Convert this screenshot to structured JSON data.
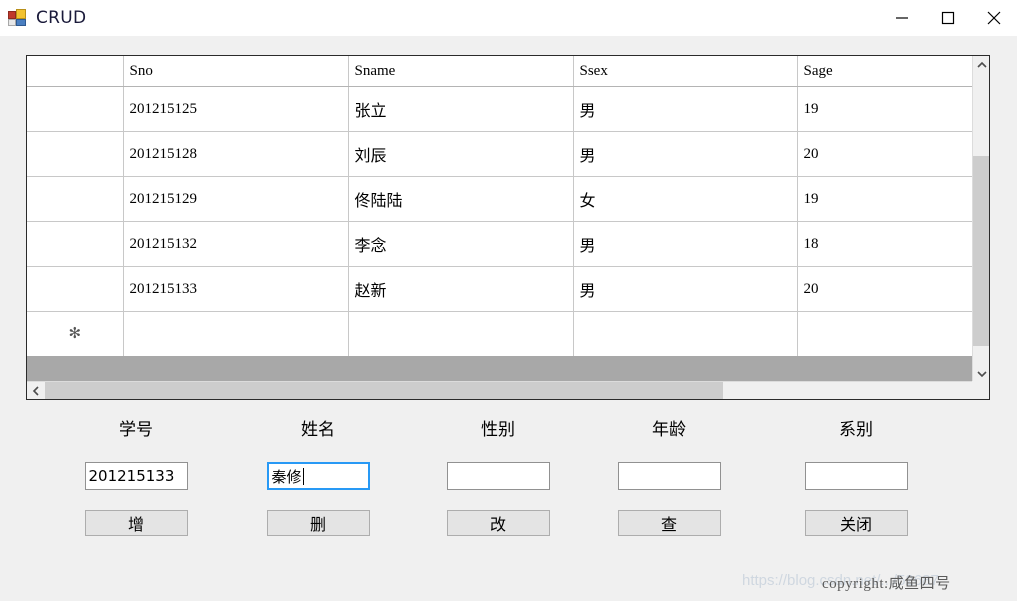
{
  "window": {
    "title": "CRUD",
    "icon": "vs-form-icon",
    "controls": {
      "minimize": "minimize-icon",
      "maximize": "maximize-icon",
      "close": "close-icon"
    }
  },
  "grid": {
    "row_header_blank": "",
    "columns": [
      "Sno",
      "Sname",
      "Ssex",
      "Sage"
    ],
    "rows": [
      {
        "sno": "201215125",
        "sname": "张立",
        "ssex": "男",
        "sage": "19"
      },
      {
        "sno": "201215128",
        "sname": "刘辰",
        "ssex": "男",
        "sage": "20"
      },
      {
        "sno": "201215129",
        "sname": "佟陆陆",
        "ssex": "女",
        "sage": "19"
      },
      {
        "sno": "201215132",
        "sname": "李念",
        "ssex": "男",
        "sage": "18"
      },
      {
        "sno": "201215133",
        "sname": "赵新",
        "ssex": "男",
        "sage": "20"
      }
    ],
    "new_row_indicator": "✻",
    "scroll": {
      "up_arrow": "chevron-up-icon",
      "down_arrow": "chevron-down-icon",
      "left_arrow": "chevron-left-icon",
      "right_arrow": "chevron-right-icon"
    }
  },
  "form": {
    "fields": [
      {
        "label": "学号",
        "value": "201215133",
        "placeholder": "",
        "focused": false
      },
      {
        "label": "姓名",
        "value": "秦修",
        "placeholder": "",
        "focused": true
      },
      {
        "label": "性别",
        "value": "",
        "placeholder": "",
        "focused": false
      },
      {
        "label": "年龄",
        "value": "",
        "placeholder": "",
        "focused": false
      },
      {
        "label": "系别",
        "value": "",
        "placeholder": "",
        "focused": false
      }
    ],
    "buttons": [
      "增",
      "删",
      "改",
      "查",
      "关闭"
    ]
  },
  "watermarks": {
    "url": "https://blog.csdn.net/.../52687",
    "copyright_prefix": "copyright:",
    "copyright_name": "咸鱼四号"
  },
  "colors": {
    "form_background": "#f0f0f0",
    "titlebar_background": "#ffffff",
    "grid_border": "#2b2b2b",
    "grid_line": "#c8c8c8",
    "focus_border": "#2899f5",
    "scroll_thumb": "#cdcdcd",
    "filler_strip": "#a8a8a8",
    "button_face": "#e4e4e4"
  }
}
